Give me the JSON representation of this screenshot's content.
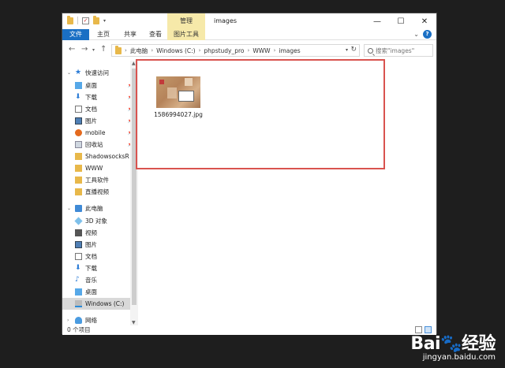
{
  "window": {
    "title": "images",
    "manage_tab": "管理",
    "controls": {
      "minimize": "—",
      "maximize": "☐",
      "close": "✕"
    }
  },
  "ribbon": {
    "tabs": [
      {
        "label": "文件"
      },
      {
        "label": "主页"
      },
      {
        "label": "共享"
      },
      {
        "label": "查看"
      },
      {
        "label": "图片工具"
      }
    ],
    "help": "?"
  },
  "address_bar": {
    "path": [
      "此电脑",
      "Windows (C:)",
      "phpstudy_pro",
      "WWW",
      "images"
    ]
  },
  "search": {
    "placeholder": "搜索\"images\""
  },
  "sidebar": {
    "quick_access": {
      "label": "快速访问",
      "items": [
        {
          "label": "桌面"
        },
        {
          "label": "下载"
        },
        {
          "label": "文档"
        },
        {
          "label": "图片"
        },
        {
          "label": "mobile"
        },
        {
          "label": "回收站"
        },
        {
          "label": "ShadowsocksR"
        },
        {
          "label": "WWW"
        },
        {
          "label": "工具软件"
        },
        {
          "label": "直播视频"
        }
      ]
    },
    "this_pc": {
      "label": "此电脑",
      "items": [
        {
          "label": "3D 对象"
        },
        {
          "label": "视频"
        },
        {
          "label": "图片"
        },
        {
          "label": "文档"
        },
        {
          "label": "下载"
        },
        {
          "label": "音乐"
        },
        {
          "label": "桌面"
        },
        {
          "label": "Windows (C:)"
        }
      ]
    },
    "network": {
      "label": "网络"
    }
  },
  "files": [
    {
      "name": "1586994027.jpg"
    }
  ],
  "status": {
    "item_count": "0 个项目"
  },
  "watermark": {
    "logo_left": "Bai",
    "logo_right": "经验",
    "url": "jingyan.baidu.com"
  },
  "colors": {
    "highlight": "#d9534f",
    "file_tab": "#1a6fc4",
    "picture_tools_tab": "#f6e9a9"
  }
}
